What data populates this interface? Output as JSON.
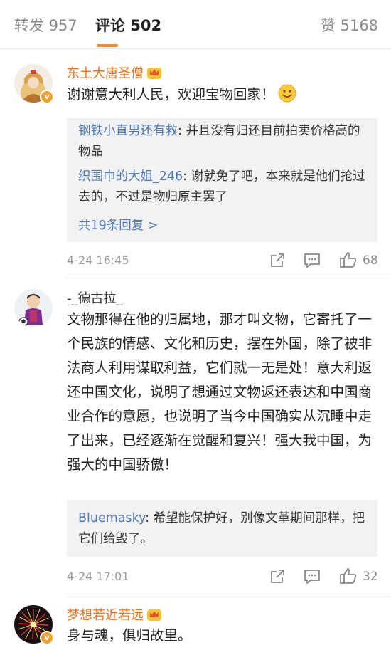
{
  "tabs": {
    "repost": "转发 957",
    "comments": "评论 502",
    "likes": "赞 5168"
  },
  "accent_color": "#f28a2c",
  "link_color": "#4d7ab6",
  "comments": [
    {
      "user": "东土大唐圣僧",
      "text": "谢谢意大利人民，欢迎宝物回家！",
      "emoji": "smile-emoji",
      "replies": [
        {
          "name": "钢铁小直男还有救",
          "text": ": 并且没有归还目前拍卖价格高的物品"
        },
        {
          "name": "织围巾的大姐_246",
          "text": ": 谢就免了吧，本来就是他们抢过去的，不过是物归原主罢了"
        }
      ],
      "more_replies": "共19条回复 >",
      "time": "4-24 16:45",
      "likes": "68"
    },
    {
      "user": "-_德古拉_",
      "text": "文物那得在他的归属地，那才叫文物，它寄托了一个民族的情感、文化和历史，摆在外国，除了被非法商人利用谋取利益，它们就一无是处！意大利返还中国文化，说明了想通过文物返还表达和中国商业合作的意愿，也说明了当今中国确实从沉睡中走了出来，已经逐渐在觉醒和复兴！强大我中国，为强大的中国骄傲！",
      "replies": [
        {
          "name": "Bluemasky",
          "text": ": 希望能保护好，别像文革期间那样，把它们给毁了。"
        }
      ],
      "time": "4-24 17:01",
      "likes": "32"
    },
    {
      "user": "梦想若近若远",
      "text": "身与魂，俱归故里。"
    }
  ]
}
